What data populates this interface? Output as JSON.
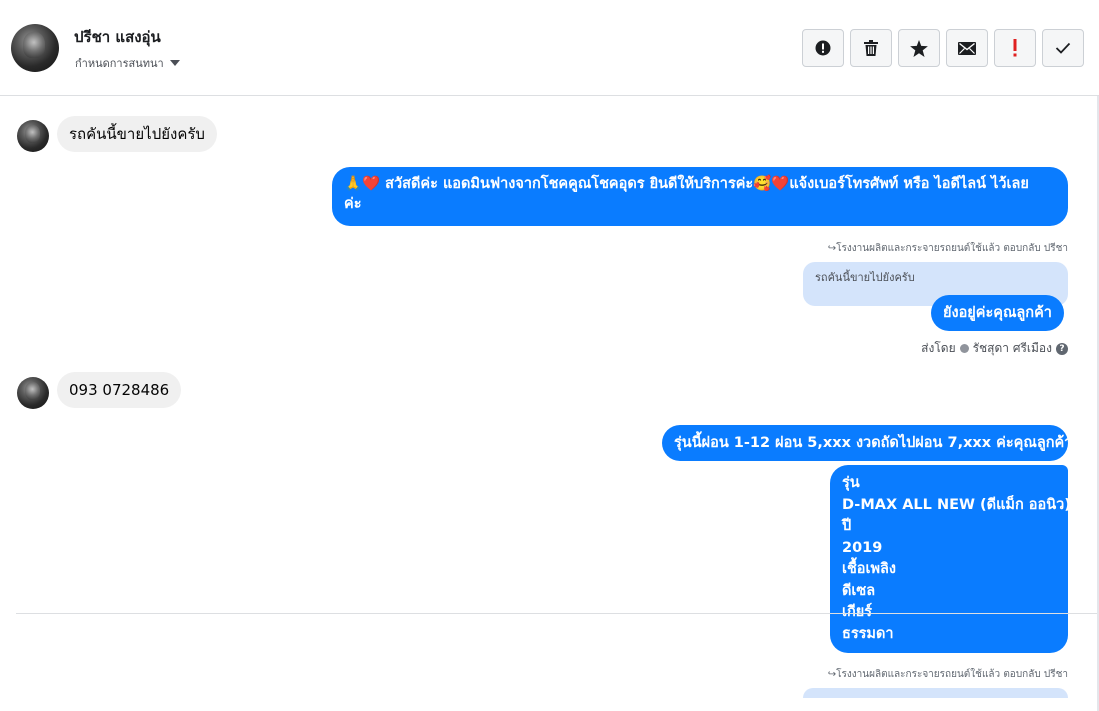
{
  "header": {
    "contact_name": "ปรีชา แสงอุ่น",
    "settings_label": "กำหนดการสนทนา",
    "toolbar": [
      {
        "name": "report-button",
        "icon": "alert-circle-icon"
      },
      {
        "name": "delete-button",
        "icon": "trash-icon"
      },
      {
        "name": "star-button",
        "icon": "star-icon"
      },
      {
        "name": "mark-unread-button",
        "icon": "envelope-icon"
      },
      {
        "name": "important-button",
        "icon": "exclamation-icon",
        "color": "#e02020"
      },
      {
        "name": "done-button",
        "icon": "check-icon"
      }
    ]
  },
  "messages": {
    "m1": "รถคันนี้ขายไปยังครับ",
    "m2_line1": "🙏❤️ สวัสดีค่ะ แอดมินฟางจากโชคคูณโชคอุดร ยินดีให้บริการค่ะ🥰❤️แจ้งเบอร์โทรศัพท์ หรือ ไอดีไลน์  ไว้เลย",
    "m2_line2": "ค่ะ",
    "reply_meta_1": "↪โรงงานผลิตและกระจายรถยนต์ใช้แล้ว ตอบกลับ ปรีชา",
    "quote_1": "รถคันนี้ขายไปยังครับ",
    "m3": "ยังอยู่ค่ะคุณลูกค้า",
    "sent_by_label": "ส่งโดย",
    "sent_by_name": "รัชสุดา ศรีเมือง",
    "m4": "093 0728486",
    "m5": "รุ่นนี้ผ่อน 1-12 ผ่อน 5,xxx งวดถัดไปผ่อน 7,xxx ค่ะคุณลูกค้า",
    "m6_lines": [
      "รุ่น",
      "D-MAX ALL NEW (ดีแม็ก ออนิว)",
      "ปี",
      "2019",
      "เชื้อเพลิง",
      "ดีเซล",
      "เกียร์",
      "ธรรมดา"
    ],
    "reply_meta_2": "↪โรงงานผลิตและกระจายรถยนต์ใช้แล้ว ตอบกลับ ปรีชา"
  },
  "colors": {
    "outgoing": "#0a7cff",
    "incoming": "#f0f0f0",
    "quote": "#d4e4fb"
  }
}
